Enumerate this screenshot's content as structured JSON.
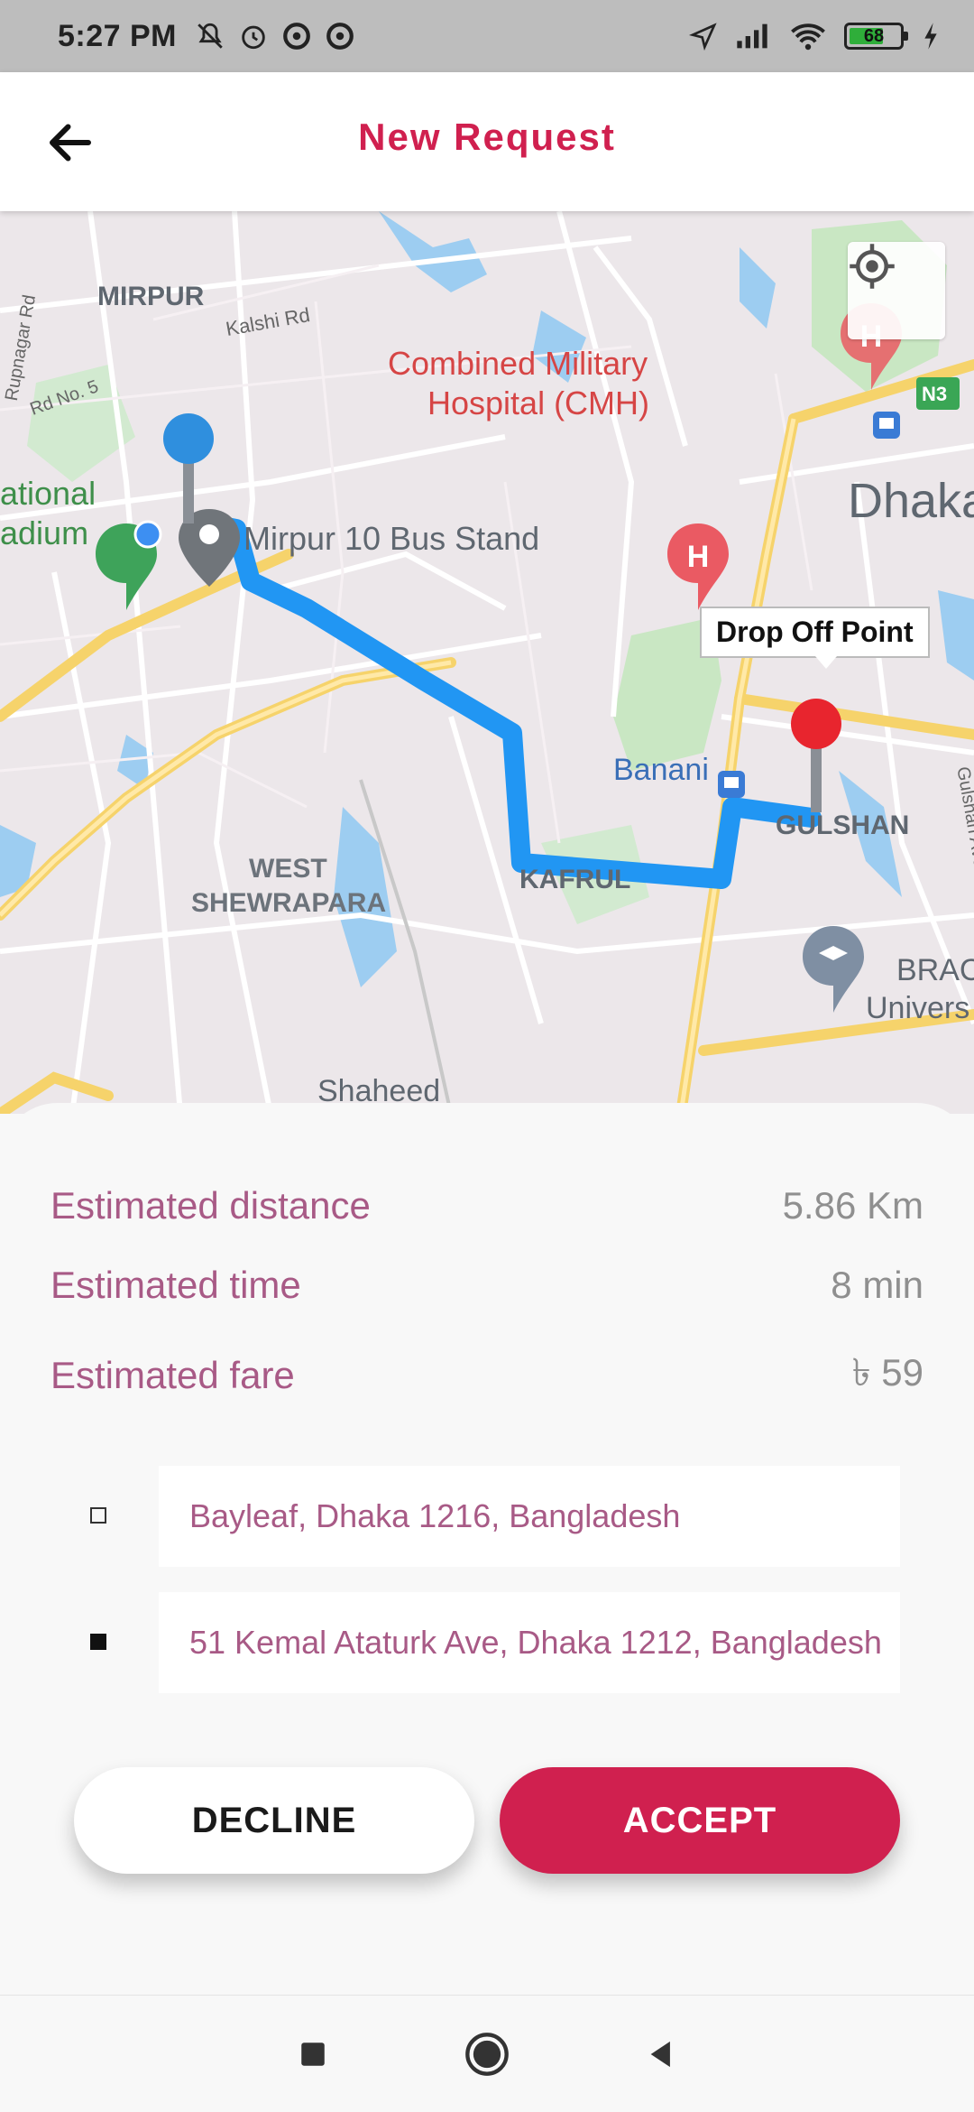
{
  "status_bar": {
    "time": "5:27 PM",
    "battery_level": "68",
    "icons": [
      "mute-icon",
      "alarm-icon",
      "notification-icon",
      "notification-icon",
      "location-arrow-icon",
      "signal-icon",
      "wifi-icon",
      "battery-icon",
      "charging-icon"
    ]
  },
  "header": {
    "title": "New Request",
    "back_icon": "arrow-left-icon"
  },
  "map": {
    "labels": {
      "mirpur": "MIRPUR",
      "kalshi_rd": "Kalshi Rd",
      "rupnagar_rd": "Rupnagar Rd",
      "rd_no_5": "Rd No. 5",
      "national": "ational",
      "stadium": "adium",
      "cmh_line1": "Combined Military",
      "cmh_line2": "Hospital (CMH)",
      "dhaka": "Dhaka",
      "n3": "N3",
      "mirpur10": "Mirpur 10 Bus Stand",
      "banani": "Banani",
      "gulshan": "GULSHAN",
      "gulshan_ave": "Gulshan Ave",
      "kafrul": "KAFRUL",
      "west": "WEST",
      "shewrapara": "SHEWRAPARA",
      "shaheed": "Shaheed",
      "brac": "BRAC",
      "univers": "Univers"
    },
    "dropoff_label": "Drop Off Point",
    "route_color": "#2196f3",
    "pickup_color": "#2f8fde",
    "dropoff_color": "#e8252e",
    "locate_icon": "my-location-icon"
  },
  "trip": {
    "distance_label": "Estimated distance",
    "distance_value": "5.86 Km",
    "time_label": "Estimated time",
    "time_value": "8 min",
    "fare_label": "Estimated fare",
    "fare_value": "৳ 59"
  },
  "addresses": {
    "pickup": "Bayleaf, Dhaka 1216, Bangladesh",
    "dropoff": "51 Kemal Ataturk Ave, Dhaka 1212, Bangladesh"
  },
  "actions": {
    "decline": "DECLINE",
    "accept": "ACCEPT"
  },
  "colors": {
    "accent": "#d0204f",
    "label": "#a85a86",
    "value": "#8f8f8f"
  },
  "nav": [
    "square-icon",
    "circle-icon",
    "triangle-back-icon"
  ]
}
